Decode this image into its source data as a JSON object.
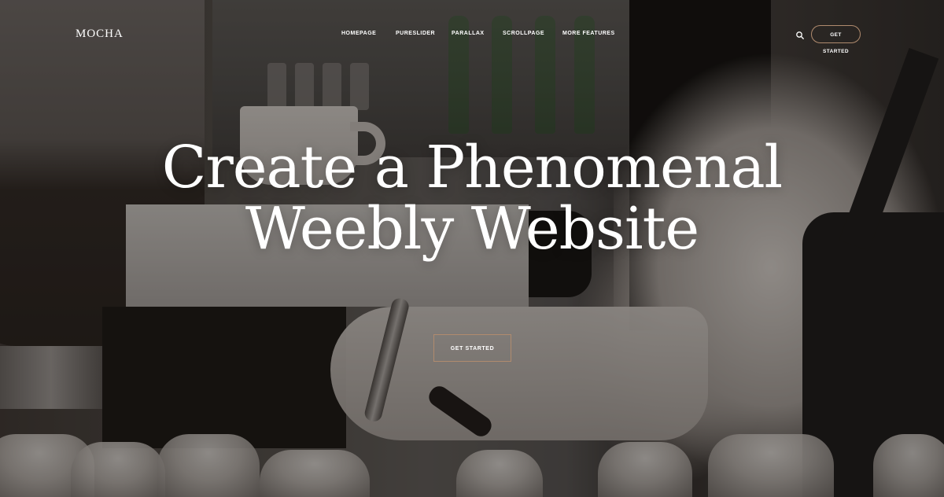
{
  "brand": {
    "logo_text": "MOCHA"
  },
  "nav": {
    "items": [
      {
        "label": "HOMEPAGE"
      },
      {
        "label": "PURESLIDER"
      },
      {
        "label": "PARALLAX"
      },
      {
        "label": "SCROLLPAGE"
      },
      {
        "label": "MORE FEATURES"
      }
    ],
    "search_icon": "search-icon",
    "cta_label": "GET STARTED"
  },
  "hero": {
    "headline_line_1": "Create a Phenomenal",
    "headline_line_2": "Weebly Website",
    "cta_label": "GET STARTED",
    "background": "cafe barista espresso machine photo"
  },
  "colors": {
    "accent_border": "#b08b6e",
    "text": "#ffffff",
    "overlay": "#161210"
  }
}
